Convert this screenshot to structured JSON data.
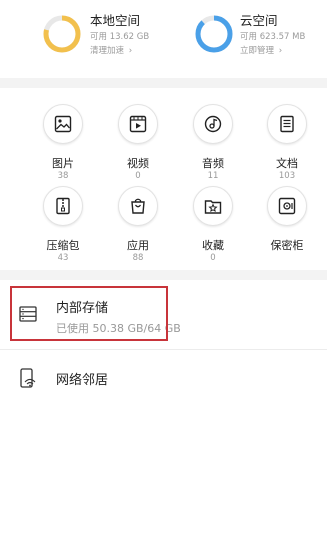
{
  "storage_cards": {
    "local": {
      "title": "本地空间",
      "available": "可用 13.62 GB",
      "action": "清理加速",
      "ring_color": "#f2c04d",
      "used_fraction": 0.79
    },
    "cloud": {
      "title": "云空间",
      "available": "可用 623.57 MB",
      "action": "立即管理",
      "ring_color": "#4aa0e8",
      "used_fraction": 0.88
    }
  },
  "categories": [
    {
      "label": "图片",
      "count": "38",
      "icon": "image-icon"
    },
    {
      "label": "视频",
      "count": "0",
      "icon": "video-icon"
    },
    {
      "label": "音频",
      "count": "11",
      "icon": "music-disc-icon"
    },
    {
      "label": "文档",
      "count": "103",
      "icon": "document-icon"
    },
    {
      "label": "压缩包",
      "count": "43",
      "icon": "zip-archive-icon"
    },
    {
      "label": "应用",
      "count": "88",
      "icon": "app-bag-icon"
    },
    {
      "label": "收藏",
      "count": "0",
      "icon": "star-folder-icon"
    },
    {
      "label": "保密柜",
      "count": "",
      "icon": "safe-icon"
    }
  ],
  "internal_storage": {
    "title": "内部存储",
    "usage": "已使用 50.38 GB/64 GB",
    "icon": "storage-icon"
  },
  "network_neighbors": {
    "title": "网络邻居",
    "icon": "network-device-icon"
  },
  "colors": {
    "accent_local": "#f2c04d",
    "accent_cloud": "#4aa0e8",
    "highlight": "#c8343a"
  }
}
